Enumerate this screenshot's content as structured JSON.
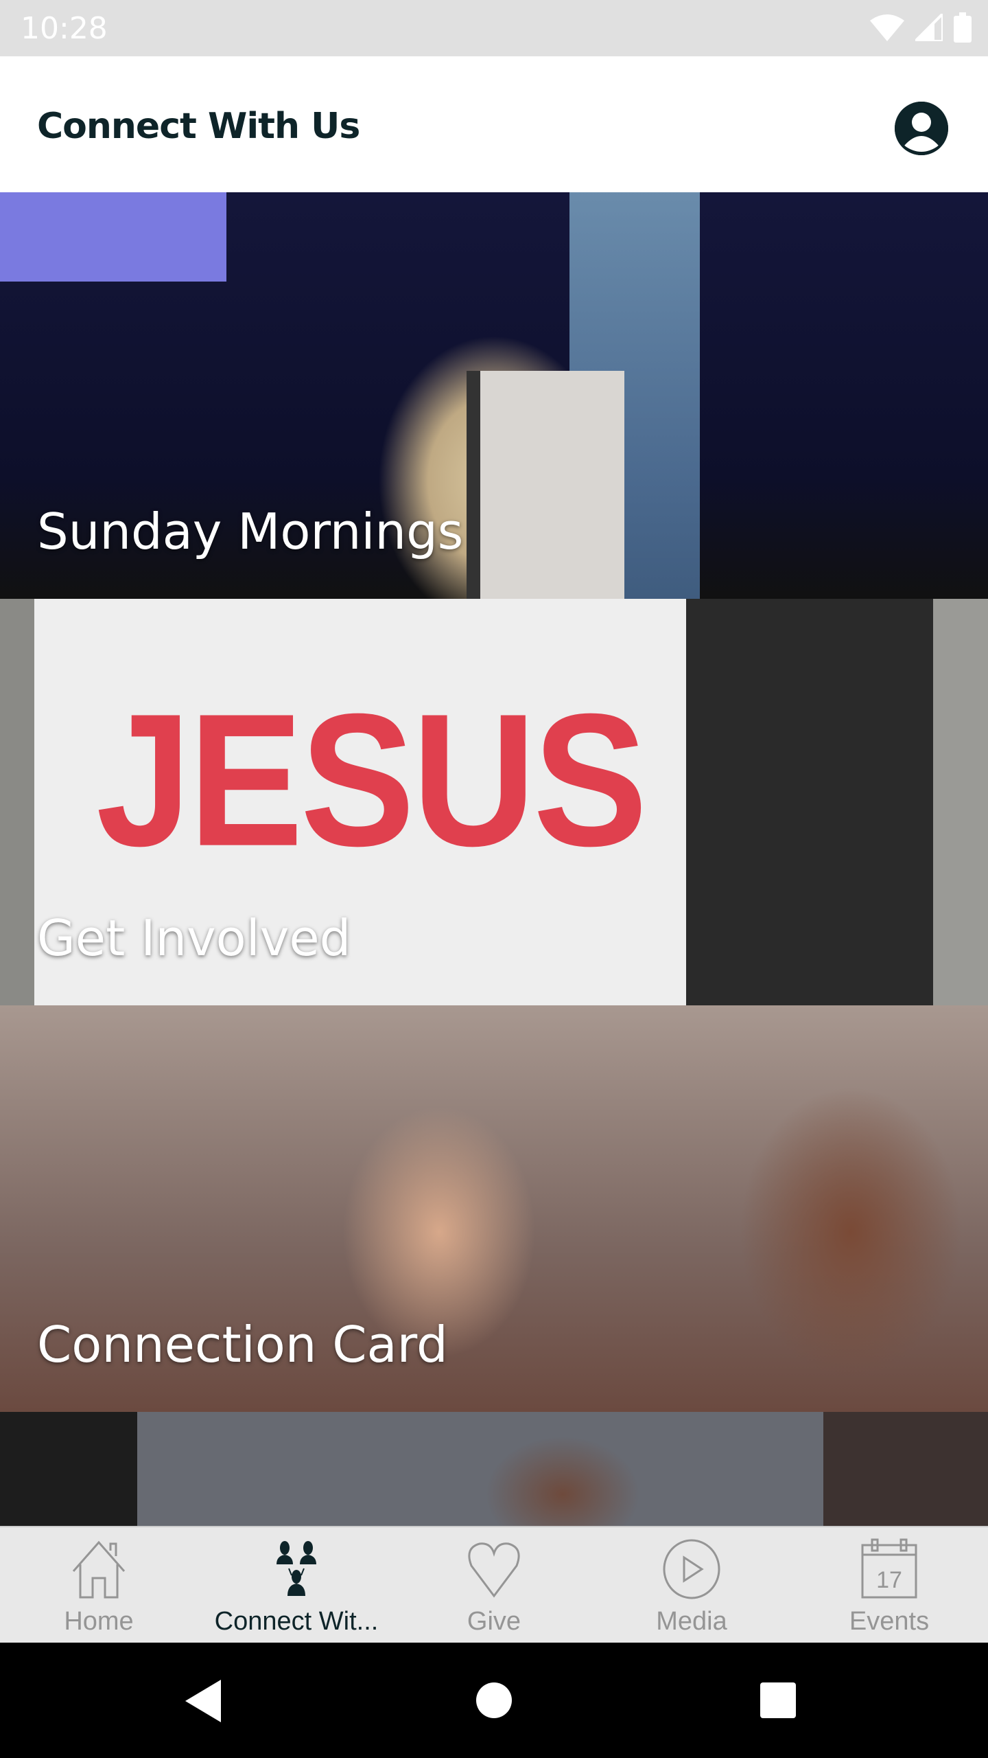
{
  "status_bar": {
    "time": "10:28",
    "icons": [
      "wifi-icon",
      "signal-icon",
      "battery-icon"
    ]
  },
  "header": {
    "title": "Connect With Us",
    "profile_icon": "account-circle-icon"
  },
  "cards": [
    {
      "label": "Sunday Mornings"
    },
    {
      "label": "Get Involved",
      "image_text": "JESUS"
    },
    {
      "label": "Connection Card"
    },
    {
      "label": ""
    }
  ],
  "tabs": [
    {
      "label": "Home",
      "icon": "home-icon",
      "active": false
    },
    {
      "label": "Connect Wit...",
      "icon": "people-icon",
      "active": true
    },
    {
      "label": "Give",
      "icon": "heart-icon",
      "active": false
    },
    {
      "label": "Media",
      "icon": "play-circle-icon",
      "active": false
    },
    {
      "label": "Events",
      "icon": "calendar-icon",
      "calendar_day": "17",
      "active": false
    }
  ],
  "colors": {
    "accent": "#0e2429",
    "inactive": "#959595",
    "tabbar_bg": "#e8e8e8"
  }
}
